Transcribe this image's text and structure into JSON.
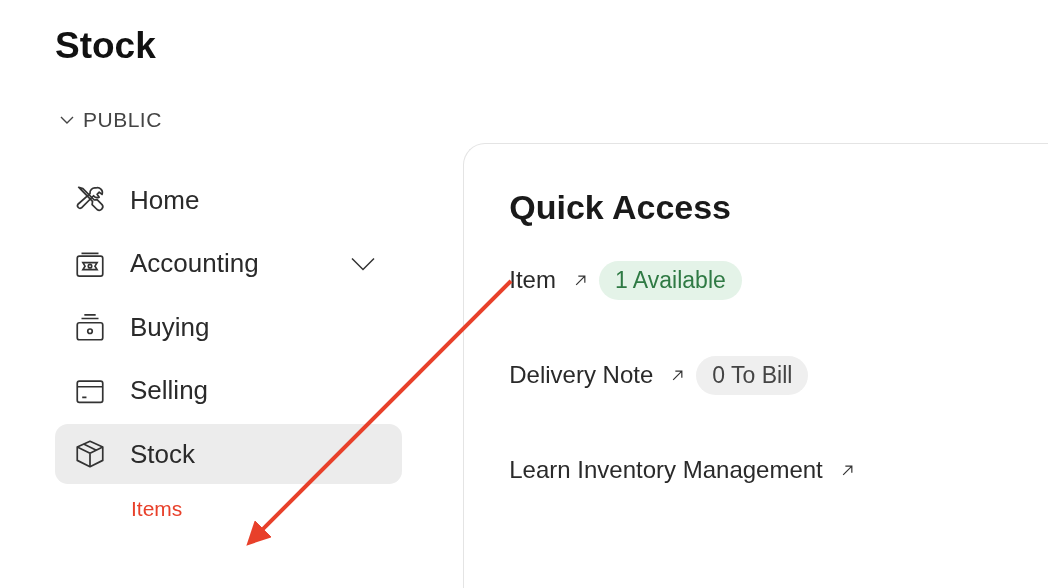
{
  "page_title": "Stock",
  "sidebar": {
    "section": {
      "label": "PUBLIC",
      "expanded": true
    },
    "items": [
      {
        "label": "Home",
        "selected": false,
        "expandable": false
      },
      {
        "label": "Accounting",
        "selected": false,
        "expandable": true
      },
      {
        "label": "Buying",
        "selected": false,
        "expandable": false
      },
      {
        "label": "Selling",
        "selected": false,
        "expandable": false
      },
      {
        "label": "Stock",
        "selected": true,
        "expandable": false
      }
    ],
    "sub_items": [
      {
        "label": "Items",
        "selected": true
      }
    ]
  },
  "quick_access": {
    "title": "Quick Access",
    "links": [
      {
        "label": "Item",
        "badge": {
          "text": "1 Available",
          "color": "#e4f3e8"
        }
      },
      {
        "label": "Delivery Note",
        "badge": {
          "text": "0 To Bill",
          "color": "#efefef"
        }
      },
      {
        "label": "Learn Inventory Management"
      }
    ]
  }
}
